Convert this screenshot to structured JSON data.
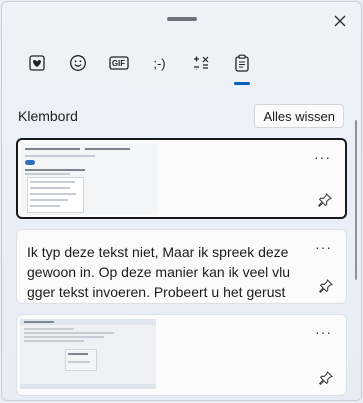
{
  "panel": {
    "close_icon": "close-icon"
  },
  "tabs": [
    {
      "name": "favorites",
      "icon": "heart-sticker-icon"
    },
    {
      "name": "emoji",
      "icon": "emoji-icon"
    },
    {
      "name": "gif",
      "icon": "gif-icon",
      "label": "GIF"
    },
    {
      "name": "kaomoji",
      "icon": "kaomoji-icon",
      "label": ";-)"
    },
    {
      "name": "symbols",
      "icon": "symbols-icon"
    },
    {
      "name": "clipboard",
      "icon": "clipboard-icon",
      "active": true
    }
  ],
  "clipboard": {
    "title": "Klembord",
    "clear_label": "Alles wissen",
    "items": [
      {
        "type": "image",
        "selected": true,
        "more_label": "···"
      },
      {
        "type": "text",
        "selected": false,
        "more_label": "···",
        "text": "Ik typ deze tekst niet, Maar ik spreek deze gewoon in. Op deze manier kan ik veel vlu gger tekst invoeren. Probeert u het gerust"
      },
      {
        "type": "image",
        "selected": false,
        "more_label": "···"
      }
    ]
  },
  "colors": {
    "accent": "#005fb8",
    "background": "#e9eef6",
    "card": "#fbfbfc"
  }
}
